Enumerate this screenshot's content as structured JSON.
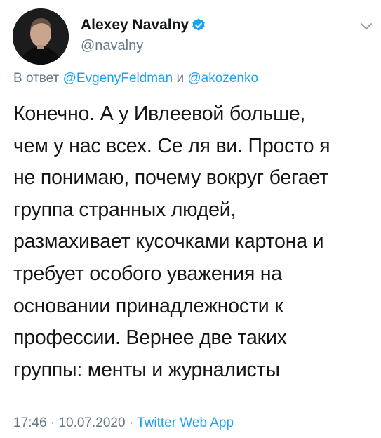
{
  "author": {
    "name": "Alexey Navalny",
    "handle": "@navalny"
  },
  "reply": {
    "prefix": "В ответ",
    "mention_1": "@EvgenyFeldman",
    "conjunction": "и",
    "mention_2": "@akozenko"
  },
  "tweet": {
    "text": "Конечно. А у Ивлеевой больше,\nчем у нас всех. Се ля ви. Просто я\nне понимаю, почему вокруг бегает\nгруппа странных людей,\nразмахивает кусочками картона и\nтребует особого уважения на\nосновании принадлежности к\nпрофессии. Вернее две таких\nгруппы: менты и журналисты"
  },
  "meta": {
    "time": "17:46",
    "separator": "·",
    "date": "10.07.2020",
    "source": "Twitter Web App"
  },
  "icons": {
    "verified": "verified-badge-icon",
    "caret": "chevron-down-icon"
  },
  "colors": {
    "link": "#1da1f2",
    "secondary_text": "#657786",
    "primary_text": "#14171a"
  }
}
